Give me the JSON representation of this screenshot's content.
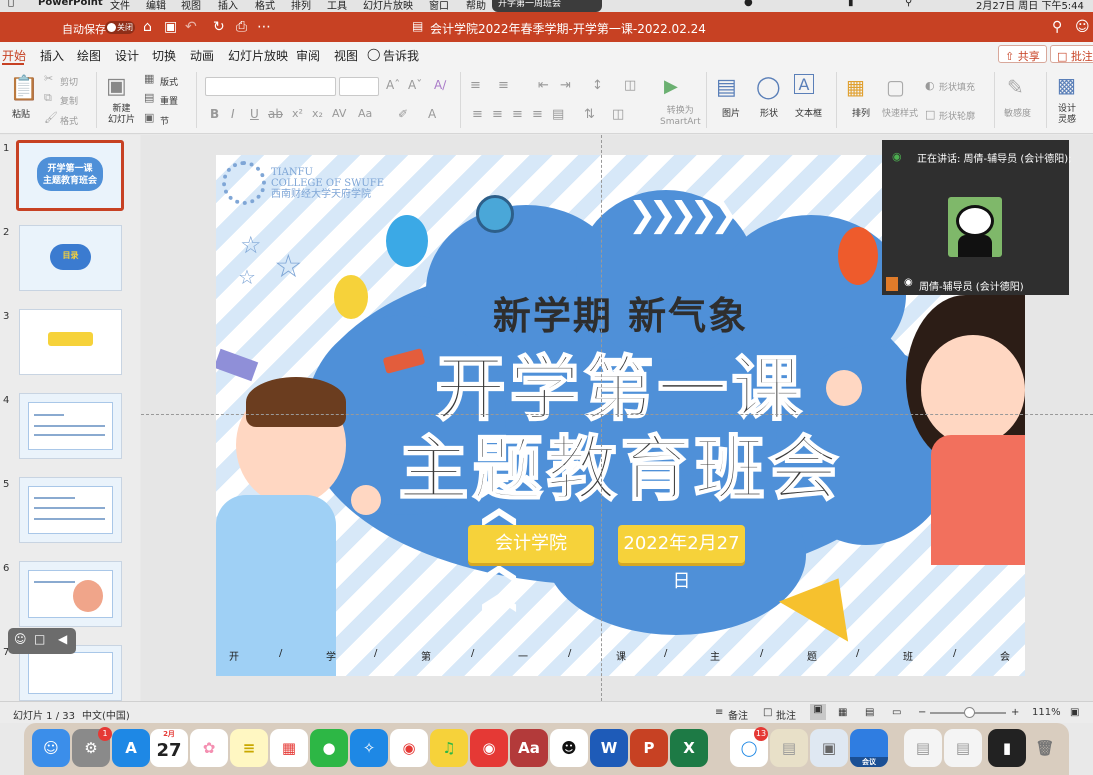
{
  "menubar": {
    "app": "PowerPoint",
    "items": [
      "文件",
      "编辑",
      "视图",
      "插入",
      "格式",
      "排列",
      "工具",
      "幻灯片放映",
      "窗口",
      "帮助"
    ],
    "meeting": "开学第一周班会",
    "clock": "2月27日 周日 下午5:44"
  },
  "titlebar": {
    "autosave_label": "自动保存",
    "autosave_state": "关闭",
    "document_title": "会计学院2022年春季学期-开学第一课-2022.02.24",
    "brand_color": "#c74123"
  },
  "tabs": [
    "开始",
    "插入",
    "绘图",
    "设计",
    "切换",
    "动画",
    "幻灯片放映",
    "审阅",
    "视图"
  ],
  "tell_me": "告诉我",
  "share_label": "共享",
  "comment_label": "批注",
  "ribbon": {
    "paste": "粘贴",
    "cut": "剪切",
    "copy": "复制",
    "format": "格式",
    "new_slide": "新建\n幻灯片",
    "layout": "版式",
    "reset": "重置",
    "section": "节",
    "convert_smartart": "转换为\nSmartArt",
    "picture": "图片",
    "shape": "形状",
    "textbox": "文本框",
    "arrange": "排列",
    "quick_styles": "快速样式",
    "shape_fill": "形状填充",
    "shape_outline": "形状轮廓",
    "sensitivity": "敏感度",
    "designer": "设计\n灵感"
  },
  "thumbnails": {
    "numbers": [
      "1",
      "2",
      "3",
      "4",
      "5",
      "6",
      "7"
    ],
    "slide1_title": "开学第一课",
    "slide1_sub": "主题教育班会",
    "slide2_label": "目录"
  },
  "slide": {
    "logo_line1": "TIANFU",
    "logo_line2": "COLLEGE OF SWUFE",
    "logo_line3": "西南财经大学天府学院",
    "subtitle": "新学期 新气象",
    "title_line1": "开学第一课",
    "title_line2": "主题教育班会",
    "college": "会计学院",
    "date": "2022年2月27日",
    "bottom_chars": [
      "开",
      "/",
      "学",
      "/",
      "第",
      "/",
      "一",
      "/",
      "课",
      "/",
      "主",
      "/",
      "题",
      "/",
      "班",
      "/",
      "会"
    ]
  },
  "video": {
    "speaking": "正在讲话: 周倩-辅导员 (会计德阳);",
    "participant": "周倩-辅导员 (会计德阳)"
  },
  "statusbar": {
    "slide_count": "幻灯片 1 / 33",
    "language": "中文(中国)",
    "notes": "备注",
    "comments": "批注",
    "zoom": "111%",
    "zoom_level": 0.55
  },
  "dock": {
    "calendar_month": "2月",
    "calendar_day": "27",
    "system_badge": "1",
    "meeting_badge": "13",
    "meeting_label": "会议"
  }
}
